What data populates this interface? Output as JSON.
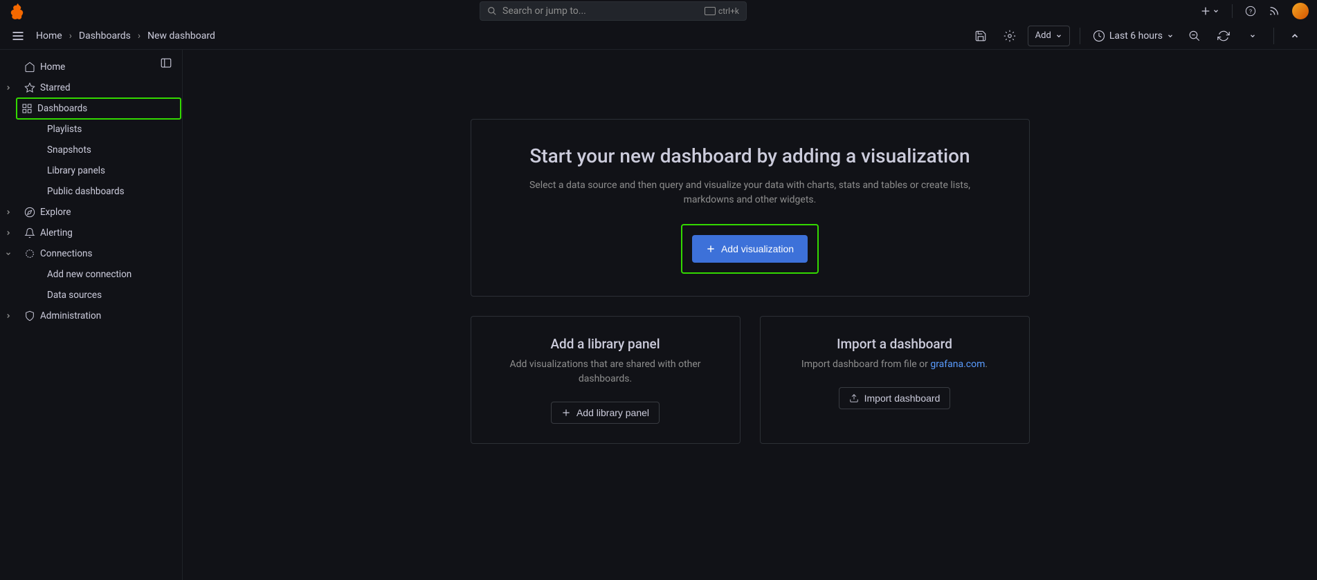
{
  "header": {
    "search_placeholder": "Search or jump to...",
    "search_shortcut": "ctrl+k"
  },
  "breadcrumb": {
    "items": [
      "Home",
      "Dashboards",
      "New dashboard"
    ]
  },
  "toolbar": {
    "add_label": "Add",
    "timerange": "Last 6 hours"
  },
  "sidebar": {
    "home": "Home",
    "starred": "Starred",
    "dashboards": "Dashboards",
    "dashboards_children": [
      "Playlists",
      "Snapshots",
      "Library panels",
      "Public dashboards"
    ],
    "explore": "Explore",
    "alerting": "Alerting",
    "connections": "Connections",
    "connections_children": [
      "Add new connection",
      "Data sources"
    ],
    "administration": "Administration"
  },
  "main_card": {
    "title": "Start your new dashboard by adding a visualization",
    "desc": "Select a data source and then query and visualize your data with charts, stats and tables or create lists, markdowns and other widgets.",
    "button": "Add visualization"
  },
  "library_card": {
    "title": "Add a library panel",
    "desc": "Add visualizations that are shared with other dashboards.",
    "button": "Add library panel"
  },
  "import_card": {
    "title": "Import a dashboard",
    "desc_prefix": "Import dashboard from file or ",
    "desc_link": "grafana.com",
    "desc_suffix": ".",
    "button": "Import dashboard"
  }
}
